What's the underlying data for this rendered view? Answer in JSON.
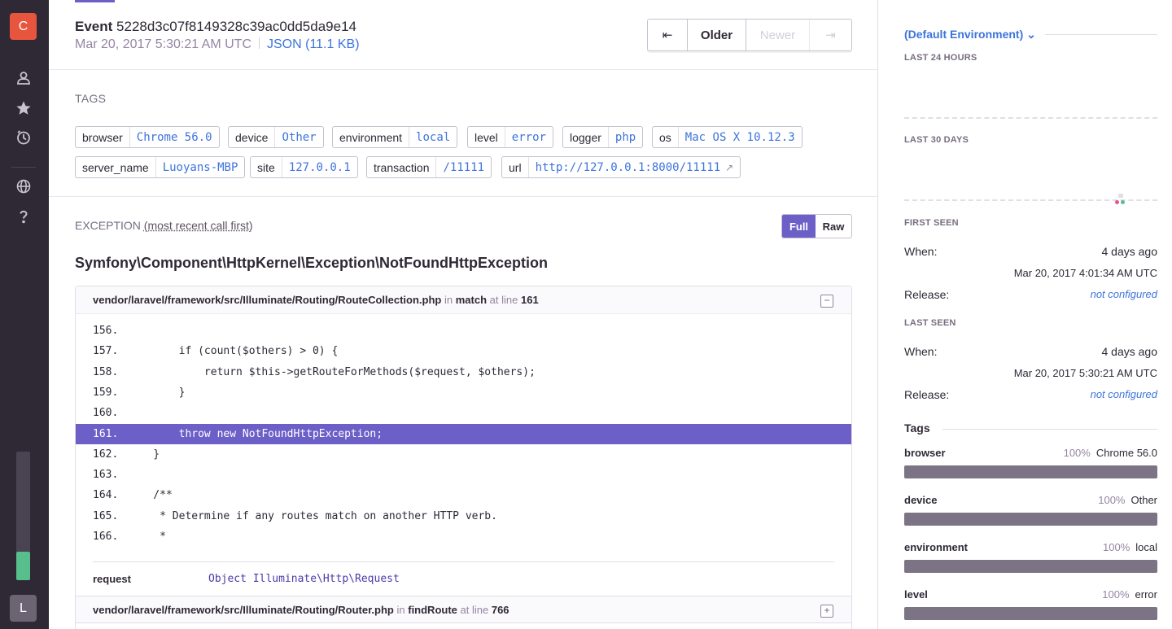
{
  "sidebar": {
    "org_initial": "C",
    "user_initial": "L",
    "usage_fraction": 0.22,
    "icons": [
      "user-icon",
      "star-icon",
      "clock-icon",
      "globe-icon",
      "help-icon"
    ]
  },
  "event": {
    "label": "Event",
    "id": "5228d3c07f8149328c39ac0dd5da9e14",
    "timestamp": "Mar 20, 2017 5:30:21 AM UTC",
    "json_link": "JSON (11.1 KB)"
  },
  "pager": {
    "first_glyph": "⇤",
    "older": "Older",
    "newer": "Newer",
    "last_glyph": "⇥"
  },
  "tags": {
    "label": "TAGS",
    "items": [
      {
        "key": "browser",
        "value": "Chrome 56.0"
      },
      {
        "key": "device",
        "value": "Other"
      },
      {
        "key": "environment",
        "value": "local"
      },
      {
        "key": "level",
        "value": "error"
      },
      {
        "key": "logger",
        "value": "php"
      },
      {
        "key": "os",
        "value": "Mac OS X 10.12.3"
      },
      {
        "key": "server_name",
        "value": "Luoyans-MBP"
      },
      {
        "key": "site",
        "value": "127.0.0.1"
      },
      {
        "key": "transaction",
        "value": "/11111"
      },
      {
        "key": "url",
        "value": "http://127.0.0.1:8000/11111"
      }
    ]
  },
  "exception": {
    "label": "EXCEPTION",
    "sublabel": "(most recent call first)",
    "toggle_full": "Full",
    "toggle_raw": "Raw",
    "type": "Symfony\\Component\\HttpKernel\\Exception\\NotFoundHttpException",
    "frame1": {
      "path": "vendor/laravel/framework/src/Illuminate/Routing/RouteCollection.php",
      "in": "in",
      "function": "match",
      "at_line": "at line",
      "line": "161",
      "toggle": "−",
      "code": [
        {
          "num": "156.",
          "text": ""
        },
        {
          "num": "157.",
          "text": "        if (count($others) > 0) {"
        },
        {
          "num": "158.",
          "text": "            return $this->getRouteForMethods($request, $others);"
        },
        {
          "num": "159.",
          "text": "        }"
        },
        {
          "num": "160.",
          "text": ""
        },
        {
          "num": "161.",
          "text": "        throw new NotFoundHttpException;"
        },
        {
          "num": "162.",
          "text": "    }"
        },
        {
          "num": "163.",
          "text": ""
        },
        {
          "num": "164.",
          "text": "    /**"
        },
        {
          "num": "165.",
          "text": "     * Determine if any routes match on another HTTP verb."
        },
        {
          "num": "166.",
          "text": "     *"
        }
      ],
      "active_index": 5,
      "var_key": "request",
      "var_value": "Object Illuminate\\Http\\Request"
    },
    "frame2": {
      "path": "vendor/laravel/framework/src/Illuminate/Routing/Router.php",
      "in": "in",
      "function": "findRoute",
      "at_line": "at line",
      "line": "766",
      "toggle": "+"
    }
  },
  "right": {
    "environment": "(Default Environment)",
    "last_24": "LAST 24 HOURS",
    "last_30": "LAST 30 DAYS",
    "first_seen": {
      "label": "FIRST SEEN",
      "when_label": "When:",
      "when": "4 days ago",
      "date": "Mar 20, 2017 4:01:34 AM UTC",
      "release_label": "Release:",
      "release": "not configured"
    },
    "last_seen": {
      "label": "LAST SEEN",
      "when_label": "When:",
      "when": "4 days ago",
      "date": "Mar 20, 2017 5:30:21 AM UTC",
      "release_label": "Release:",
      "release": "not configured"
    },
    "tags_title": "Tags",
    "tag_dist": [
      {
        "name": "browser",
        "pct": "100%",
        "value": "Chrome 56.0",
        "fraction": 1.0
      },
      {
        "name": "device",
        "pct": "100%",
        "value": "Other",
        "fraction": 1.0
      },
      {
        "name": "environment",
        "pct": "100%",
        "value": "local",
        "fraction": 1.0
      },
      {
        "name": "level",
        "pct": "100%",
        "value": "error",
        "fraction": 1.0
      }
    ]
  },
  "colors": {
    "accent": "#6c5fc7",
    "link": "#3d74db",
    "org_avatar": "#e8553e",
    "usage": "#57be8c"
  }
}
